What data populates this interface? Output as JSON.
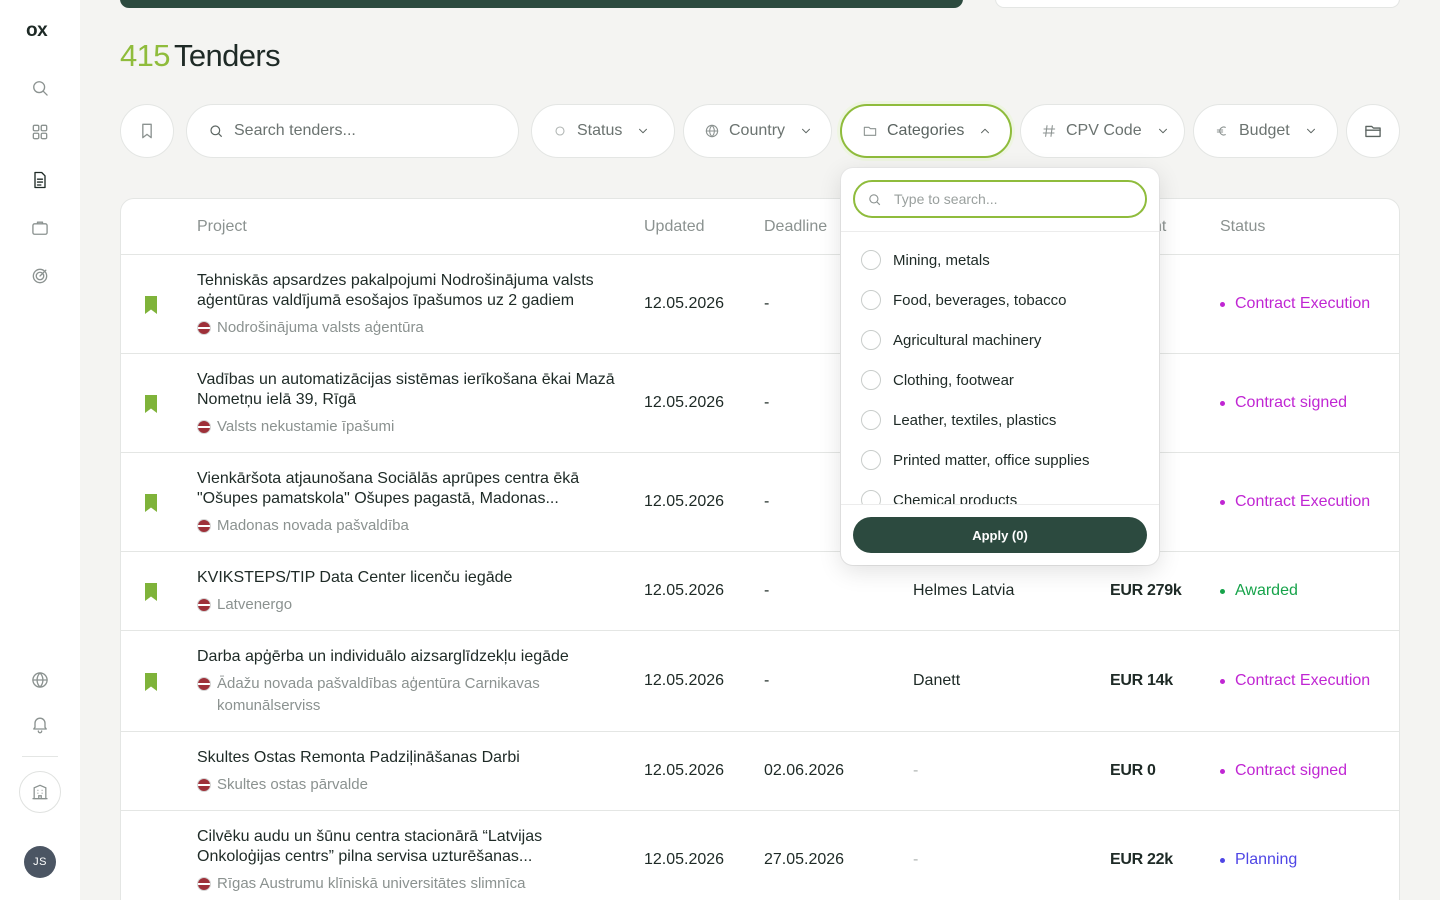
{
  "sidebar": {
    "logo": "ox",
    "avatar_initials": "JS",
    "icons": [
      "search-icon",
      "grid-icon",
      "document-icon",
      "briefcase-icon",
      "target-icon",
      "globe-icon",
      "bell-icon",
      "building-icon"
    ]
  },
  "header": {
    "count": "415",
    "title": "Tenders"
  },
  "filters": {
    "search_placeholder": "Search tenders...",
    "status_label": "Status",
    "country_label": "Country",
    "categories_label": "Categories",
    "cpv_label": "CPV Code",
    "budget_label": "Budget"
  },
  "table": {
    "columns": {
      "project": "Project",
      "updated": "Updated",
      "deadline": "Deadline",
      "amount_partial": "nt",
      "status": "Status"
    },
    "rows": [
      {
        "title": "Tehniskās apsardzes pakalpojumi Nodrošinājuma valsts aģentūras valdījumā esošajos īpašumos uz 2 gadiem",
        "org": "Nodrošinājuma valsts aģentūra",
        "updated": "12.05.2026",
        "deadline": "-",
        "winner": "",
        "amount": ":",
        "status": "Contract Execution",
        "bookmarked": true
      },
      {
        "title": "Vadības un automatizācijas sistēmas ierīkošana ēkai Mazā Nometņu ielā 39, Rīgā",
        "org": "Valsts nekustamie īpašumi",
        "updated": "12.05.2026",
        "deadline": "-",
        "winner": "",
        "amount": "'k",
        "status": "Contract signed",
        "bookmarked": true
      },
      {
        "title": "Vienkāršota atjaunošana Sociālās aprūpes centra ēkā \"Ošupes pamatskola\" Ošupes pagastā, Madonas...",
        "org": "Madonas novada pašvaldība",
        "updated": "12.05.2026",
        "deadline": "-",
        "winner": "",
        "amount": "-k",
        "status": "Contract Execution",
        "bookmarked": true
      },
      {
        "title": "KVIKSTEPS/TIP Data Center licenču iegāde",
        "org": "Latvenergo",
        "updated": "12.05.2026",
        "deadline": "-",
        "winner": "Helmes Latvia",
        "amount": "EUR 279k",
        "status": "Awarded",
        "bookmarked": true
      },
      {
        "title": "Darba apģērba un individuālo aizsarglīdzekļu iegāde",
        "org": "Ādažu novada pašvaldības aģentūra Carnikavas komunālserviss",
        "updated": "12.05.2026",
        "deadline": "-",
        "winner": "Danett",
        "amount": "EUR 14k",
        "status": "Contract Execution",
        "bookmarked": true
      },
      {
        "title": "Skultes Ostas Remonta Padziļināšanas Darbi",
        "org": "Skultes ostas pārvalde",
        "updated": "12.05.2026",
        "deadline": "02.06.2026",
        "winner": "-",
        "amount": "EUR 0",
        "status": "Contract signed",
        "bookmarked": false
      },
      {
        "title": "Cilvēku audu un šūnu centra stacionārā “Latvijas Onkoloģijas centrs” pilna servisa uzturēšanas...",
        "org": "Rīgas Austrumu klīniskā universitātes slimnīca",
        "updated": "12.05.2026",
        "deadline": "27.05.2026",
        "winner": "-",
        "amount": "EUR 22k",
        "status": "Planning",
        "bookmarked": false
      }
    ]
  },
  "status_colors": {
    "Contract Execution": "#c026d3",
    "Contract signed": "#c026d3",
    "Awarded": "#16a34a",
    "Planning": "#4f46e5"
  },
  "dropdown": {
    "search_placeholder": "Type to search...",
    "options": [
      "Mining, metals",
      "Food, beverages, tobacco",
      "Agricultural machinery",
      "Clothing, footwear",
      "Leather, textiles, plastics",
      "Printed matter, office supplies",
      "Chemical products"
    ],
    "apply_label": "Apply (0)"
  },
  "colors": {
    "accent_green": "#8fbc3c",
    "dark_green": "#2c4a3f",
    "bookmark": "#7fb33a"
  }
}
